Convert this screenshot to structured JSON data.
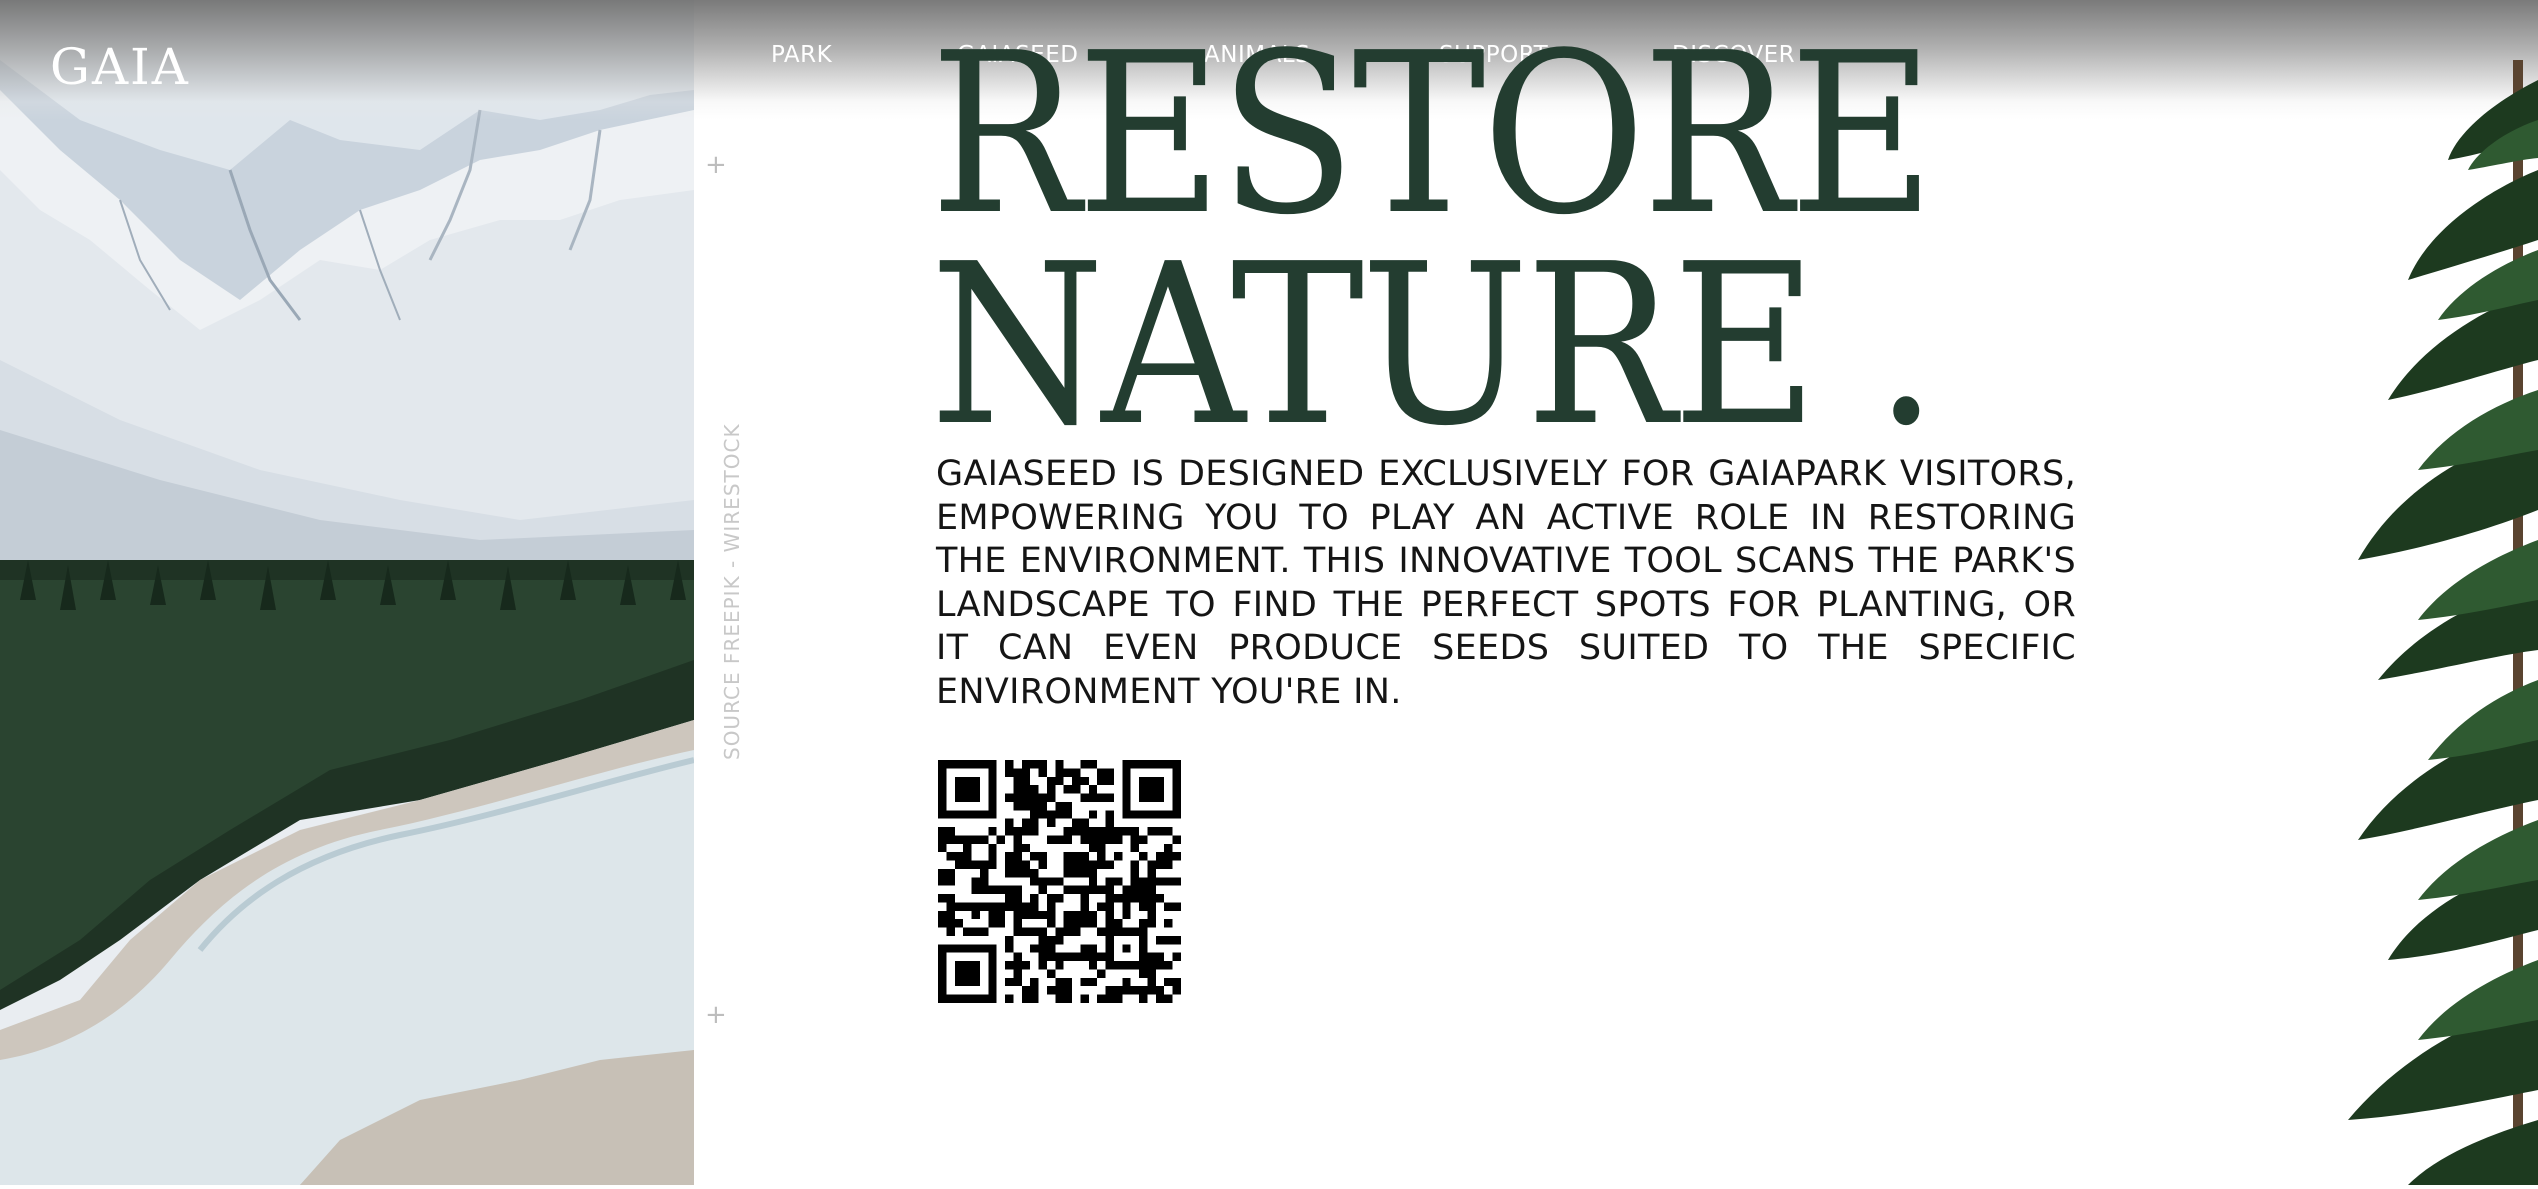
{
  "brand": {
    "logo_text": "GAIA"
  },
  "nav": {
    "items": [
      "PARK",
      "GAIASEED",
      "ANIMALS",
      "SUPPORT",
      "DISCOVER"
    ]
  },
  "side": {
    "credit": "SOURCE FREEPIK - WIRESTOCK",
    "plus_top": "+",
    "plus_bottom": "+"
  },
  "hero": {
    "headline_line1": "RESTORE",
    "headline_line2": "NATURE .",
    "description": "GAIASEED IS DESIGNED EXCLUSIVELY FOR GAIAPARK VISITORS, EMPOWERING YOU TO PLAY AN ACTIVE ROLE IN RESTORING THE ENVIRONMENT. THIS INNOVATIVE TOOL SCANS THE PARK'S LANDSCAPE TO FIND THE PERFECT SPOTS FOR PLANTING, OR IT CAN EVEN PRODUCE SEEDS SUITED TO THE SPECIFIC ENVIRONMENT YOU'RE IN."
  },
  "colors": {
    "headline": "#233d30",
    "text": "#151515",
    "nav_text": "#ffffff"
  },
  "icons": {
    "qr": "qr-code-icon",
    "plus": "plus-icon"
  }
}
